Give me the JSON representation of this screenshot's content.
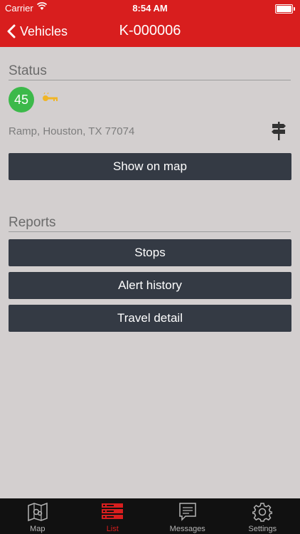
{
  "status_bar": {
    "carrier": "Carrier",
    "time": "8:54 AM"
  },
  "nav": {
    "back_label": "Vehicles",
    "title": "K-000006"
  },
  "status_section": {
    "header": "Status",
    "speed": "45",
    "address": "Ramp, Houston, TX 77074",
    "show_on_map_label": "Show on map"
  },
  "reports_section": {
    "header": "Reports",
    "buttons": [
      "Stops",
      "Alert history",
      "Travel detail"
    ]
  },
  "tab_bar": {
    "tabs": [
      {
        "label": "Map",
        "icon": "map-icon"
      },
      {
        "label": "List",
        "icon": "list-icon",
        "active": true
      },
      {
        "label": "Messages",
        "icon": "messages-icon"
      },
      {
        "label": "Settings",
        "icon": "settings-icon"
      }
    ]
  },
  "colors": {
    "brand_red": "#d81e1e",
    "background": "#d3cfcf",
    "button_dark": "#343a44",
    "speed_green": "#3cb94a",
    "ignition_yellow": "#f0b526"
  }
}
